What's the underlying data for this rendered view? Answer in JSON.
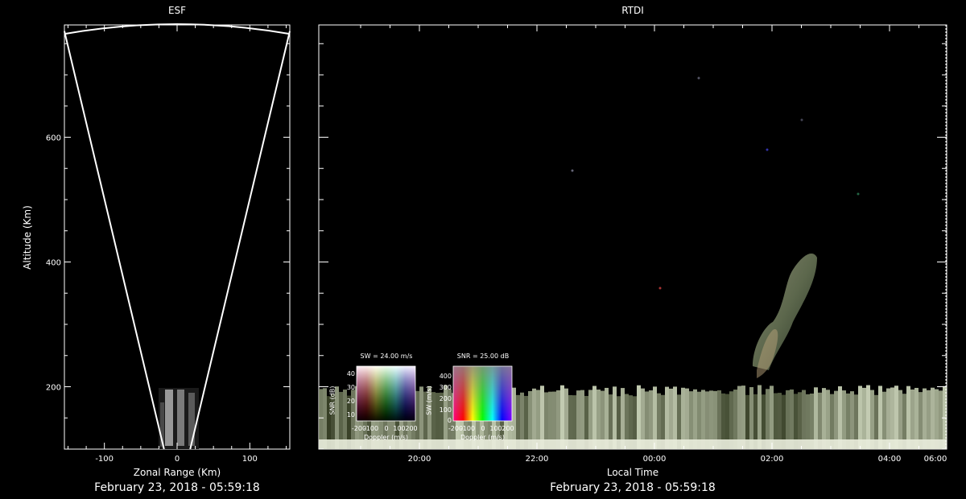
{
  "colors": {
    "background": "#000000",
    "axis": "#ffffff",
    "echo_base": "#e9ecdc"
  },
  "chart_data": [
    {
      "type": "scatter",
      "title": "ESF",
      "xlabel": "Zonal Range (Km)",
      "ylabel": "Altitude (Km)",
      "xlim": [
        -155,
        155
      ],
      "ylim": [
        100,
        780
      ],
      "xticks": [
        "-100",
        "0",
        "100"
      ],
      "yticks": [
        "200",
        "400",
        "600"
      ],
      "date_label": "February 23, 2018 - 05:59:18",
      "beam_edges": [
        {
          "x_start": -155,
          "x_end": -18,
          "y_top": 770,
          "y_bottom": 100
        },
        {
          "x_start": 155,
          "x_end": 18,
          "y_top": 770,
          "y_bottom": 100
        }
      ],
      "echo_region": {
        "x_range": [
          -40,
          40
        ],
        "altitude_range": [
          100,
          200
        ]
      }
    },
    {
      "type": "heatmap",
      "title": "RTDI",
      "xlabel": "Local Time",
      "ylabel": "",
      "xticks": [
        "20:00",
        "22:00",
        "00:00",
        "02:00",
        "04:00",
        "06:00"
      ],
      "ylim": [
        100,
        780
      ],
      "date_label": "February 23, 2018 - 05:59:18",
      "colorbars": [
        {
          "title": "SW = 24.00 m/s",
          "xlabel": "Doppler (m/s)",
          "ylabel": "SNR (dB)",
          "xticks": [
            "-200",
            "-100",
            "0",
            "100",
            "200"
          ],
          "yticks": [
            "40",
            "30",
            "20",
            "10"
          ]
        },
        {
          "title": "SNR = 25.00 dB",
          "xlabel": "Doppler (m/s)",
          "ylabel": "SW (m/s)",
          "xticks": [
            "-200",
            "-100",
            "0",
            "100",
            "200"
          ],
          "yticks": [
            "400",
            "300",
            "200",
            "100",
            "0"
          ]
        }
      ],
      "echo_layers": [
        {
          "name": "bottomside",
          "altitude_range": [
            100,
            200
          ]
        },
        {
          "name": "plume",
          "time_range": [
            "02:20",
            "03:20"
          ],
          "altitude_range": [
            200,
            420
          ]
        }
      ]
    }
  ]
}
